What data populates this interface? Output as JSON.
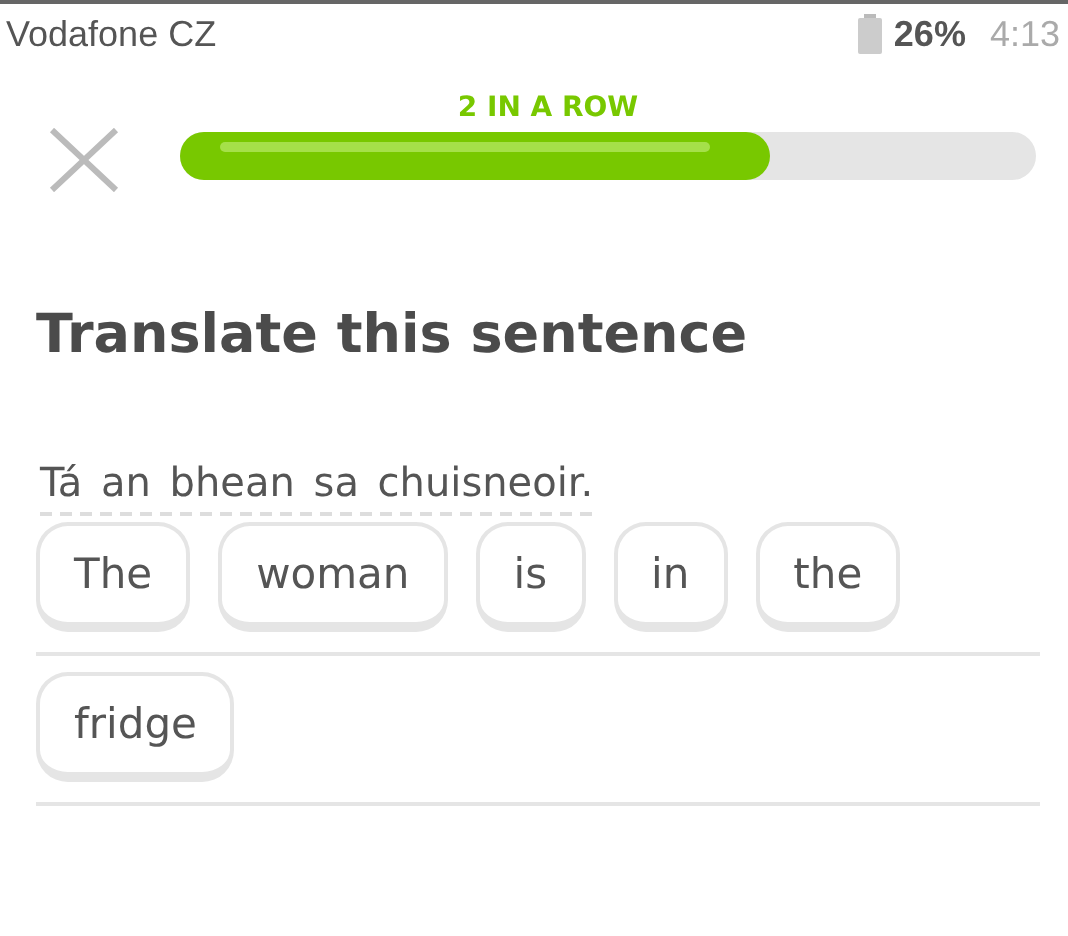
{
  "status_bar": {
    "carrier": "Vodafone CZ",
    "battery": "26%",
    "time": "4:13"
  },
  "progress": {
    "streak": "2 IN A ROW",
    "level": 0.69
  },
  "title": "Translate this sentence",
  "sentence": "Tá an bhean sa chuisneoir.",
  "answer_lines": [
    [
      "The",
      "woman",
      "is",
      "in",
      "the"
    ],
    [
      "fridge"
    ]
  ]
}
